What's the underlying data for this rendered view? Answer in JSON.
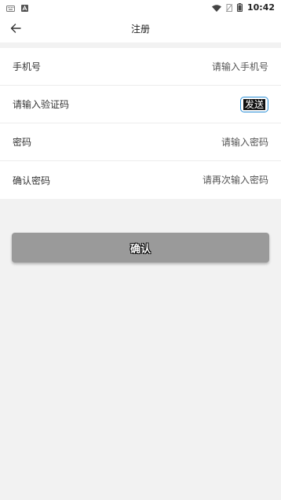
{
  "status_bar": {
    "time": "10:42",
    "icons": [
      "keyboard-icon",
      "notification-a-icon",
      "wifi-icon",
      "no-sim-icon",
      "battery-icon"
    ]
  },
  "app_bar": {
    "title": "注册",
    "back_icon": "arrow-left-icon"
  },
  "form": {
    "phone": {
      "label": "手机号",
      "placeholder": "请输入手机号"
    },
    "code": {
      "label": "请输入验证码",
      "send_label": "发送"
    },
    "password": {
      "label": "密码",
      "placeholder": "请输入密码"
    },
    "confirm_password": {
      "label": "确认密码",
      "placeholder": "请再次输入密码"
    }
  },
  "confirm_button": {
    "label": "确认",
    "color": "#9a9a9a"
  },
  "colors": {
    "background": "#f2f2f2",
    "surface": "#ffffff",
    "accent": "#2b8fd6"
  }
}
